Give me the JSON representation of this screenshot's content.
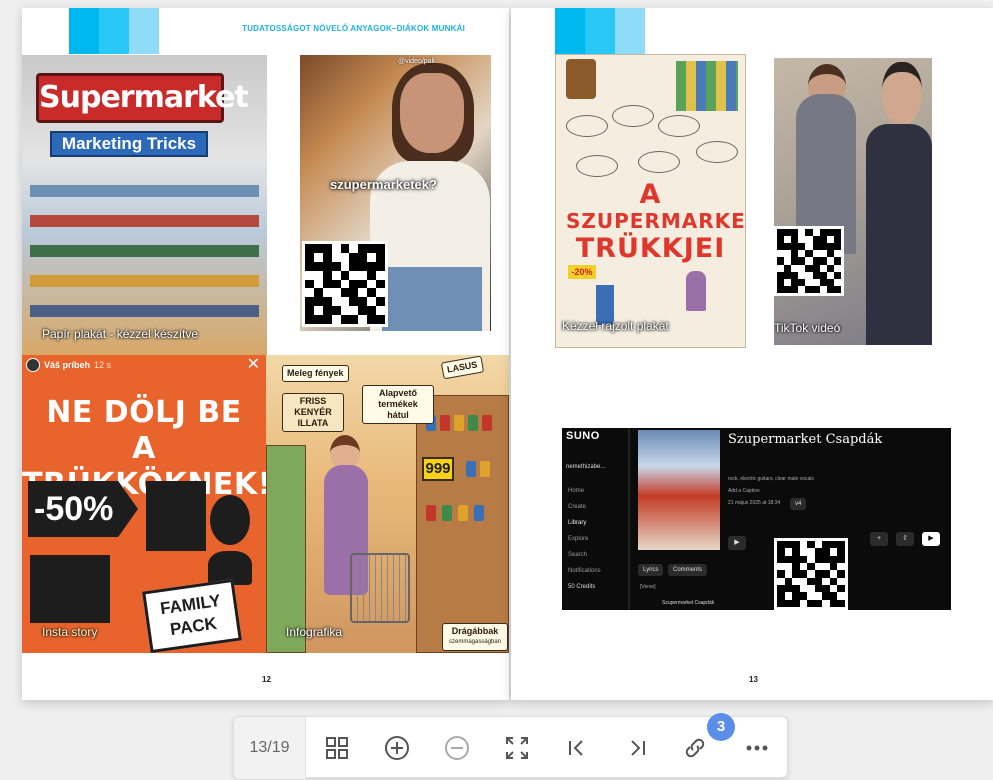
{
  "viewer": {
    "page_indicator": "13/19",
    "links_badge": "3"
  },
  "left_page": {
    "header": "TUDATOSSÁGOT NÖVELŐ ANYAGOK–DIÁKOK MUNKÁI",
    "page_number": "12",
    "tiles": {
      "paper_poster": {
        "sign_main": "Supermarket",
        "sign_sub": "Marketing Tricks",
        "caption": "Papír plakát - kézzel készítve"
      },
      "video": {
        "handle": "@video/pali",
        "overlay": "szupermarketek?"
      },
      "insta": {
        "story_label": "Váš príbeh",
        "story_time": "12 s",
        "title_line1": "NE DÖLJ BE",
        "title_line2": "A TRÜKKÖKNEK!",
        "percent": "-50%",
        "family_pack_line1": "FAMILY",
        "family_pack_line2": "PACK",
        "caption": "Insta story"
      },
      "infographic": {
        "tag_lights": "Meleg fények",
        "tag_bread": "FRISS KENYÉR ILLATA",
        "tag_basics": "Alapvető termékek hátul",
        "tag_sign": "LASUS",
        "price": "999",
        "tag_expensive": "Drágábbak",
        "tag_eye_level": "szemmagasságban",
        "caption": "Infografika"
      }
    }
  },
  "right_page": {
    "page_number": "13",
    "tiles": {
      "hand_drawn": {
        "title_line1": "A",
        "title_line2": "SZUPERMARKETEK",
        "title_line3": "TRÜKKJEI",
        "discount": "-20%",
        "caption": "Kézzel rajzolt plakát"
      },
      "tiktok": {
        "caption": "TikTok videó"
      },
      "suno": {
        "logo": "SUNO",
        "song_title": "Szupermarket Csapdák",
        "user": "nemethizabe...",
        "tags": "rock, electric guitars, clear male vocals",
        "add_caption": "Add a Caption",
        "date": "21 május 2025 at 18:34",
        "version": "v4",
        "nav": [
          "Home",
          "Create",
          "Library",
          "Explore",
          "Search",
          "Notifications"
        ],
        "credits": "50 Credits",
        "tab_lyrics": "Lyrics",
        "tab_comments": "Comments",
        "verse": "[Verse]",
        "track_name": "Szupermarket Csapdák"
      }
    }
  },
  "toolbar": {
    "icons": [
      "grid-view-icon",
      "zoom-in-icon",
      "zoom-out-icon",
      "fullscreen-icon",
      "first-page-icon",
      "last-page-icon",
      "links-icon",
      "more-icon"
    ]
  }
}
